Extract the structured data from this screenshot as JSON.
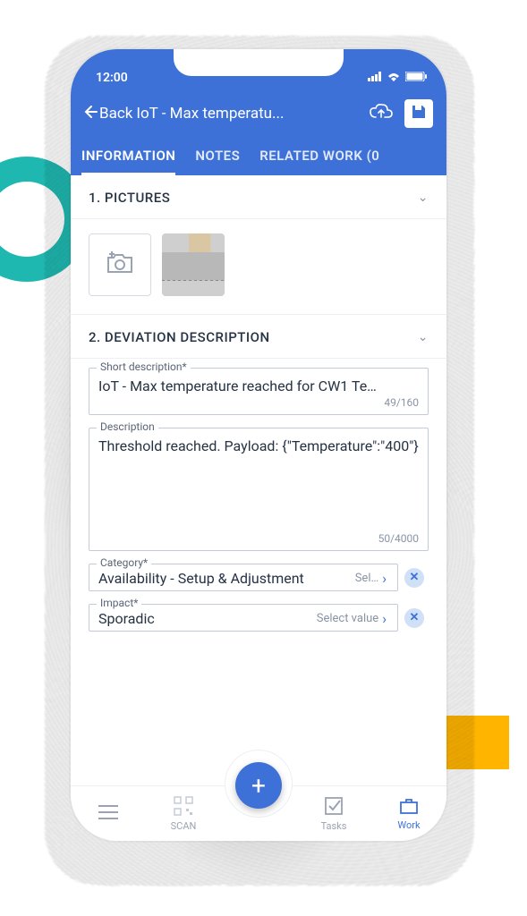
{
  "status": {
    "time": "12:00"
  },
  "header": {
    "back_label": "Back",
    "title": "IoT - Max temperatu...",
    "tabs": [
      "INFORMATION",
      "NOTES",
      "RELATED WORK (0"
    ]
  },
  "sections": {
    "pictures": {
      "title": "1. PICTURES"
    },
    "deviation": {
      "title": "2. DEVIATION DESCRIPTION",
      "short_desc": {
        "label": "Short description*",
        "value": "IoT - Max temperature reached for CW1 Te…",
        "counter": "49/160"
      },
      "description": {
        "label": "Description",
        "value": "Threshold reached. Payload: {\"Temperature\":\"400\"}",
        "counter": "50/4000"
      },
      "category": {
        "label": "Category*",
        "value": "Availability - Setup & Adjustment",
        "hint": "Sel…"
      },
      "impact": {
        "label": "Impact*",
        "value": "Sporadic",
        "hint": "Select value"
      }
    }
  },
  "nav": {
    "scan": "SCAN",
    "tasks": "Tasks",
    "work": "Work"
  }
}
